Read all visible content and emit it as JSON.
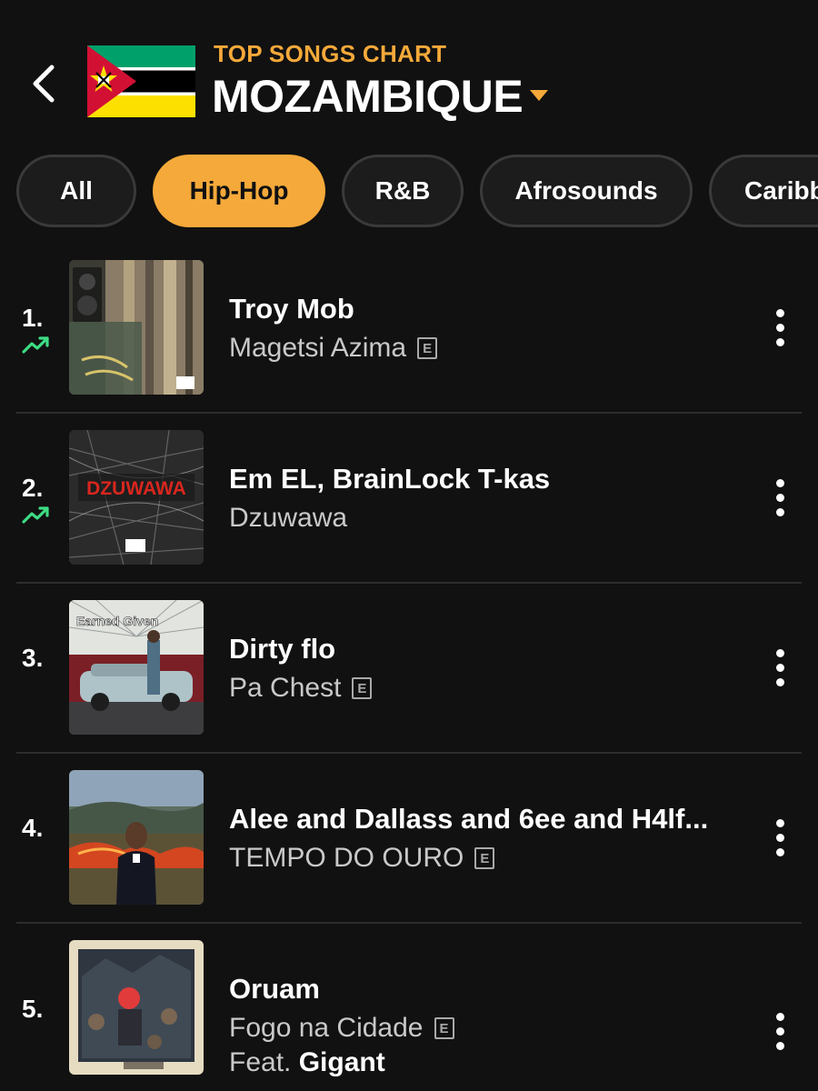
{
  "colors": {
    "accent": "#F5A93A",
    "background": "#111111",
    "trend_up": "#3DDC84"
  },
  "header": {
    "back_icon": "chevron-left-icon",
    "kicker": "TOP SONGS CHART",
    "country": "MOZAMBIQUE",
    "country_caret_icon": "caret-down-icon",
    "flag_icon": "mozambique-flag-icon"
  },
  "genres": {
    "items": [
      {
        "label": "All",
        "active": false
      },
      {
        "label": "Hip-Hop",
        "active": true
      },
      {
        "label": "R&B",
        "active": false
      },
      {
        "label": "Afrosounds",
        "active": false
      },
      {
        "label": "Caribbean",
        "active": false
      }
    ]
  },
  "songs": [
    {
      "rank": "1.",
      "trend": "up",
      "title": "Troy Mob",
      "artist": "Magetsi Azima",
      "explicit": true,
      "explicit_label": "E",
      "feat_label": "",
      "feat_artist": ""
    },
    {
      "rank": "2.",
      "trend": "up",
      "title": "Em EL, BrainLock T-kas",
      "artist": "Dzuwawa",
      "explicit": false,
      "explicit_label": "",
      "feat_label": "",
      "feat_artist": "",
      "art_text": "DZUWAWA"
    },
    {
      "rank": "3.",
      "trend": "none",
      "title": "Dirty flo",
      "artist": "Pa Chest",
      "explicit": true,
      "explicit_label": "E",
      "feat_label": "",
      "feat_artist": "",
      "art_text": "Earned Given"
    },
    {
      "rank": "4.",
      "trend": "none",
      "title": "Alee and Dallass and 6ee and H4lf...",
      "artist": "TEMPO DO OURO",
      "explicit": true,
      "explicit_label": "E",
      "feat_label": "",
      "feat_artist": ""
    },
    {
      "rank": "5.",
      "trend": "none",
      "title": "Oruam",
      "artist": "Fogo na Cidade",
      "explicit": true,
      "explicit_label": "E",
      "feat_label": "Feat.",
      "feat_artist": "Gigant"
    }
  ],
  "row_more_icon": "more-vertical-icon",
  "trend_icon": "trending-up-icon"
}
